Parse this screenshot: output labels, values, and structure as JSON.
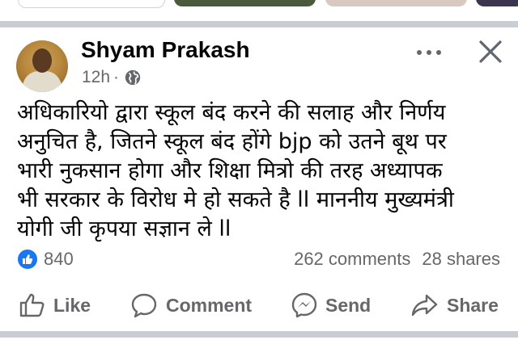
{
  "post": {
    "author": "Shyam Prakash",
    "time": "12h",
    "separator": "·",
    "audience_icon": "globe-icon",
    "text_lines": [
      "अधिकारियो द्वारा स्कूल बंद करने की सलाह और निर्णय",
      "अनुचित है, जितने स्कूल बंद होंगे bjp  को उतने बूथ पर",
      "भारी नुकसान होगा और शिक्षा मित्रो की तरह अध्यापक",
      "भी सरकार के विरोध मे हो सकते है ll माननीय मुख्यमंत्री",
      "योगी जी कृपया सज्ञान ले ll"
    ],
    "reaction_count": "840",
    "comments": "262 comments",
    "shares": "28 shares"
  },
  "actions": {
    "like": "Like",
    "comment": "Comment",
    "send": "Send",
    "share": "Share"
  },
  "colors": {
    "accent": "#1877f2",
    "text_secondary": "#65676b",
    "divider": "#c9ccd1"
  }
}
